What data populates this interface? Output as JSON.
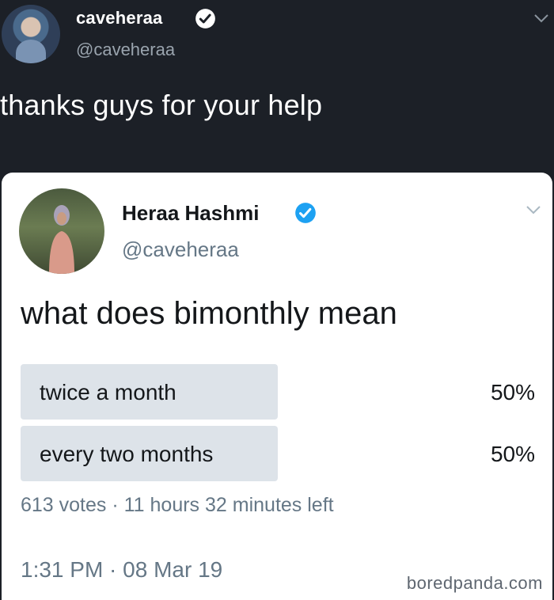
{
  "outer_tweet": {
    "display_name": "caveheraa",
    "handle": "@caveheraa",
    "text": "thanks guys for your help"
  },
  "quoted_tweet": {
    "display_name": "Heraa Hashmi",
    "handle": "@caveheraa",
    "text": "what does bimonthly mean",
    "poll": {
      "options": [
        {
          "label": "twice a month",
          "percent_text": "50%",
          "percent": 50
        },
        {
          "label": "every two months",
          "percent_text": "50%",
          "percent": 50
        }
      ],
      "meta": "613 votes · 11 hours 32 minutes left"
    },
    "timestamp": "1:31 PM · 08 Mar 19"
  },
  "watermark": "boredpanda.com",
  "colors": {
    "verified_badge": "#1da1f2",
    "poll_bar": "#dde3e9"
  },
  "icons": {
    "verified": "verified-badge-icon",
    "menu": "chevron-down-icon"
  }
}
